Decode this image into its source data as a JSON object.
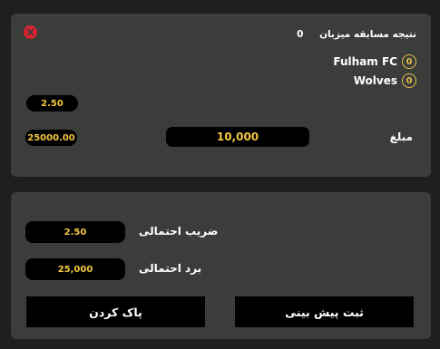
{
  "ticket": {
    "title": "نتیجه مسابقه میزبان",
    "count": "0",
    "teams": [
      {
        "name": "Fulham FC",
        "score": "0"
      },
      {
        "name": "Wolves",
        "score": "0"
      }
    ],
    "odds": "2.50",
    "stake_label": "مبلغ",
    "stake_value": "10,000",
    "max_amount": "25000.00"
  },
  "summary": {
    "odds_label": "ضریب احتمالی",
    "odds_value": "2.50",
    "win_label": "برد احتمالی",
    "win_value": "25,000",
    "submit_label": "ثبت پیش بینی",
    "clear_label": "پاک کردن"
  },
  "colors": {
    "accent": "#f2c744",
    "close": "#d8232f",
    "card": "#3b3d3b",
    "background": "#1e201f"
  },
  "icons": {
    "close": "close-circle-icon"
  }
}
